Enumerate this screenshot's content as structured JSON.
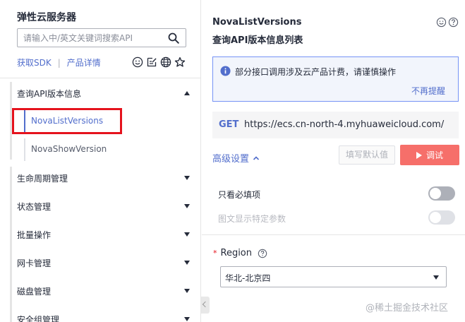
{
  "sidebar": {
    "service_title": "弹性云服务器",
    "search_placeholder": "请输入中/英文关键词搜索API",
    "sdk_link": "获取SDK",
    "separator": "|",
    "product_link": "产品详情",
    "tool_icons": [
      "smile-icon",
      "edit-note-icon",
      "globe-icon",
      "star-icon"
    ],
    "categories": [
      {
        "label": "查询API版本信息",
        "expanded": true
      },
      {
        "label": "生命周期管理",
        "expanded": false
      },
      {
        "label": "状态管理",
        "expanded": false
      },
      {
        "label": "批量操作",
        "expanded": false
      },
      {
        "label": "网卡管理",
        "expanded": false
      },
      {
        "label": "磁盘管理",
        "expanded": false
      },
      {
        "label": "安全组管理",
        "expanded": false
      }
    ],
    "sub_items": [
      {
        "label": "NovaListVersions",
        "active": true
      },
      {
        "label": "NovaShowVersion",
        "active": false
      }
    ]
  },
  "detail": {
    "api_name": "NovaListVersions",
    "api_desc": "查询API版本信息列表",
    "notice_text": "部分接口调用涉及云产品计费，请谨慎操作",
    "notice_dismiss": "不再提醒",
    "method": "GET",
    "url": "https://ecs.cn-north-4.myhuaweicloud.com/",
    "advanced_label": "高级设置",
    "fill_default_button": "填写默认值",
    "debug_button": "调试",
    "toggle_required_label": "只看必填项",
    "toggle_specific_label": "图文显示特定参数",
    "required_mark": "*",
    "region_label": "Region",
    "region_value": "华北-北京四"
  },
  "watermark": "@稀土掘金技术社区",
  "colors": {
    "accent": "#526ecc",
    "danger_button": "#f66f6a",
    "highlight_box": "#e5131d"
  }
}
